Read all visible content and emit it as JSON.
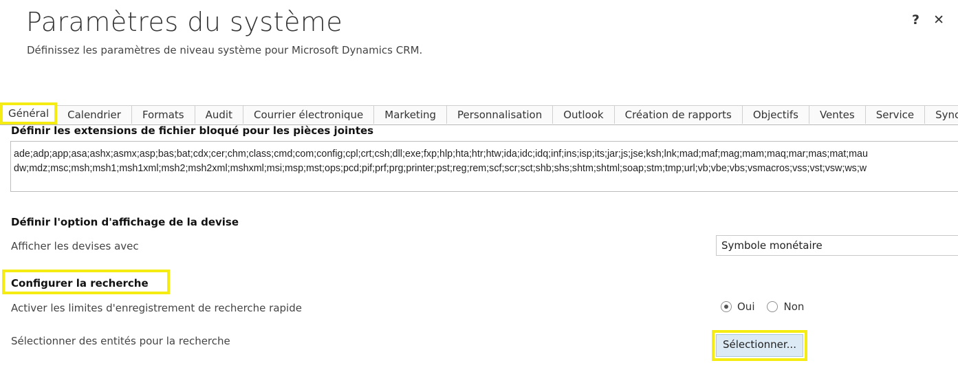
{
  "header": {
    "title": "Paramètres du système",
    "subtitle": "Définissez les paramètres de niveau système pour Microsoft Dynamics CRM.",
    "help_icon": "?",
    "close_icon": "✕"
  },
  "tabs": [
    {
      "label": "Général",
      "active": true
    },
    {
      "label": "Calendrier"
    },
    {
      "label": "Formats"
    },
    {
      "label": "Audit"
    },
    {
      "label": "Courrier électronique"
    },
    {
      "label": "Marketing"
    },
    {
      "label": "Personnalisation"
    },
    {
      "label": "Outlook"
    },
    {
      "label": "Création de rapports"
    },
    {
      "label": "Objectifs"
    },
    {
      "label": "Ventes"
    },
    {
      "label": "Service"
    },
    {
      "label": "Synch"
    }
  ],
  "blocked_extensions": {
    "heading": "Définir les extensions de fichier bloqué pour les pièces jointes",
    "line1": "ade;adp;app;asa;ashx;asmx;asp;bas;bat;cdx;cer;chm;class;cmd;com;config;cpl;crt;csh;dll;exe;fxp;hlp;hta;htr;htw;ida;idc;idq;inf;ins;isp;its;jar;js;jse;ksh;lnk;mad;maf;mag;mam;maq;mar;mas;mat;mau",
    "line2": "dw;mdz;msc;msh;msh1;msh1xml;msh2;msh2xml;mshxml;msi;msp;mst;ops;pcd;pif;prf;prg;printer;pst;reg;rem;scf;scr;sct;shb;shs;shtm;shtml;soap;stm;tmp;url;vb;vbe;vbs;vsmacros;vss;vst;vsw;ws;w"
  },
  "currency": {
    "heading": "Définir l'option d'affichage de la devise",
    "label": "Afficher les devises avec",
    "selected": "Symbole monétaire"
  },
  "search": {
    "heading": "Configurer la recherche",
    "quick_limit_label": "Activer les limites d'enregistrement de recherche rapide",
    "option_yes": "Oui",
    "option_no": "Non",
    "selected_option": "Oui",
    "entities_label": "Sélectionner des entités pour la recherche",
    "select_button": "Sélectionner..."
  },
  "colors": {
    "highlight": "#f4ec13",
    "button_bg": "#dceaf6"
  }
}
